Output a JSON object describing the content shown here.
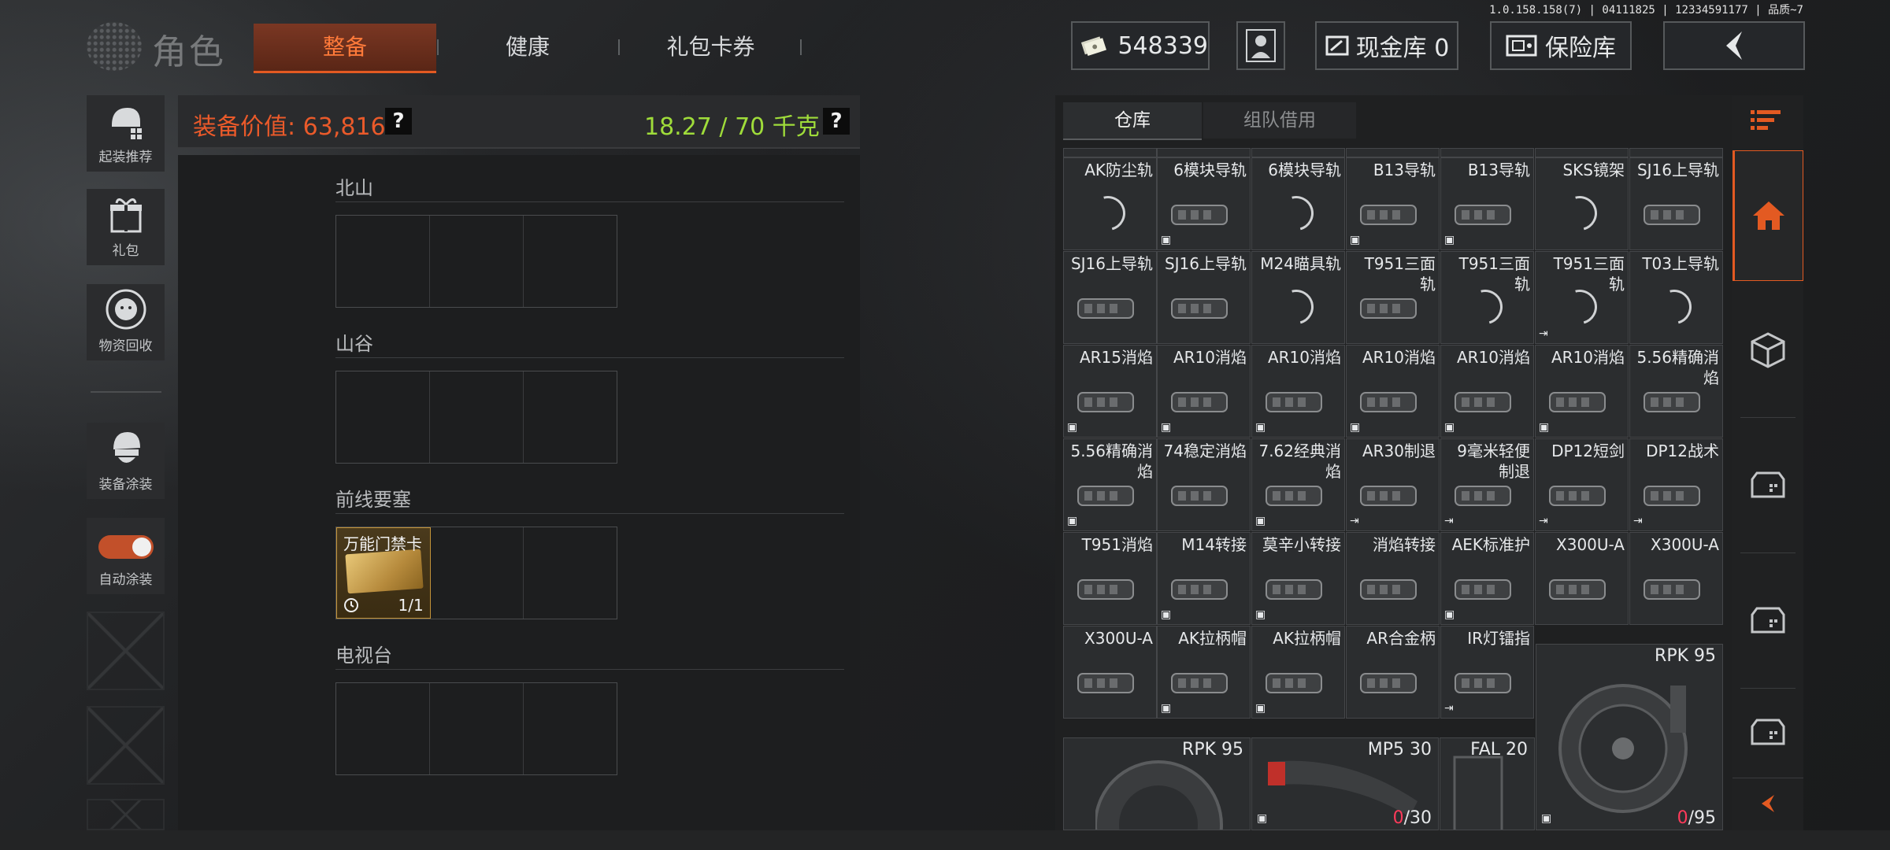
{
  "version_text": "1.0.158.158(7) | 04111825 | 12334591177 | 品质~7",
  "header": {
    "title": "角色",
    "tabs": [
      "整备",
      "健康",
      "礼包卡券"
    ],
    "currency_amount": "548339",
    "cash_vault": "现金库 0",
    "safe_box": "保险库"
  },
  "sidebar": {
    "buttons": [
      "起装推荐",
      "礼包",
      "物资回收",
      "装备涂装",
      "自动涂装"
    ]
  },
  "equipment": {
    "value_label": "装备价值: 63,816",
    "weight_label": "18.27 / 70 千克",
    "help": "?",
    "maps": [
      {
        "name": "北山"
      },
      {
        "name": "山谷"
      },
      {
        "name": "前线要塞",
        "card_name": "万能门禁卡",
        "card_count": "1/1"
      },
      {
        "name": "电视台"
      }
    ]
  },
  "warehouse": {
    "tabs": [
      "仓库",
      "组队借用"
    ],
    "items": [
      {
        "name": "AK防尘轨"
      },
      {
        "name": "6模块导轨"
      },
      {
        "name": "6模块导轨"
      },
      {
        "name": "B13导轨"
      },
      {
        "name": "B13导轨"
      },
      {
        "name": "SKS镜架"
      },
      {
        "name": "SJ16上导轨"
      },
      {
        "name": "SJ16上导轨"
      },
      {
        "name": "SJ16上导轨"
      },
      {
        "name": "M24瞄具轨"
      },
      {
        "name": "T951三面轨"
      },
      {
        "name": "T951三面轨"
      },
      {
        "name": "T951三面轨"
      },
      {
        "name": "T03上导轨"
      },
      {
        "name": "AR15消焰"
      },
      {
        "name": "AR10消焰"
      },
      {
        "name": "AR10消焰"
      },
      {
        "name": "AR10消焰"
      },
      {
        "name": "AR10消焰"
      },
      {
        "name": "AR10消焰"
      },
      {
        "name": "5.56精确消焰"
      },
      {
        "name": "5.56精确消焰"
      },
      {
        "name": "74稳定消焰"
      },
      {
        "name": "7.62经典消焰"
      },
      {
        "name": "AR30制退"
      },
      {
        "name": "9毫米轻便制退"
      },
      {
        "name": "DP12短剑"
      },
      {
        "name": "DP12战术"
      },
      {
        "name": "T951消焰"
      },
      {
        "name": "M14转接"
      },
      {
        "name": "莫辛小转接"
      },
      {
        "name": "消焰转接"
      },
      {
        "name": "AEK标准护"
      },
      {
        "name": "X300U-A"
      },
      {
        "name": "X300U-A"
      },
      {
        "name": "X300U-A"
      },
      {
        "name": "AK拉柄帽"
      },
      {
        "name": "AK拉柄帽"
      },
      {
        "name": "AR合金柄"
      },
      {
        "name": "IR灯镭指"
      }
    ],
    "big_items": [
      {
        "name": "RPK 95",
        "count_zero": "0",
        "count_rest": "/95"
      },
      {
        "name": "RPK 95"
      },
      {
        "name": "MP5 30",
        "count_zero": "0",
        "count_rest": "/30"
      },
      {
        "name": "FAL 20"
      }
    ]
  }
}
